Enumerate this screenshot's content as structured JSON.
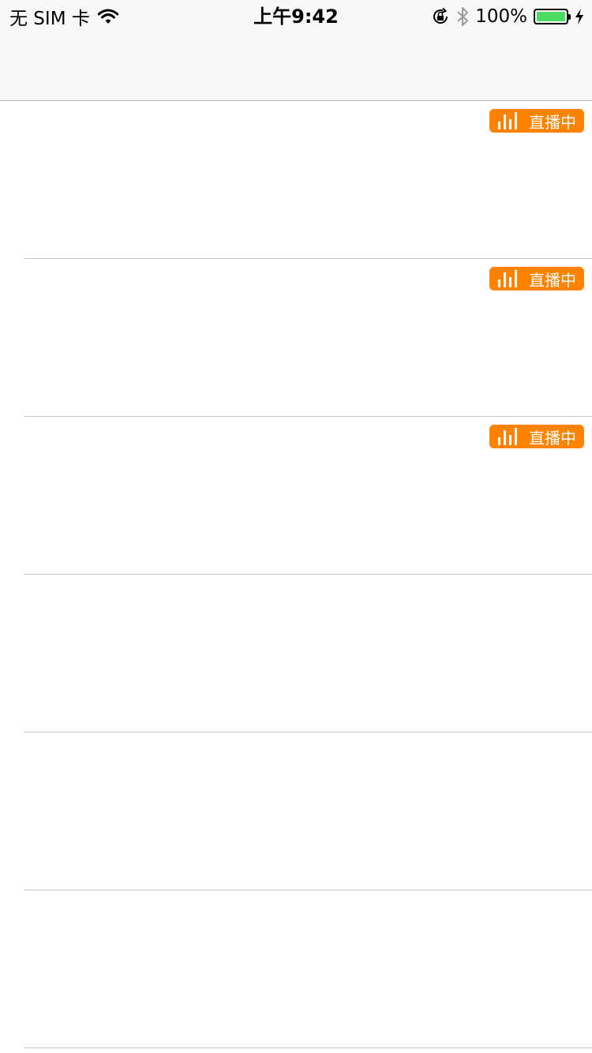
{
  "status_bar": {
    "carrier": "无 SIM 卡",
    "time": "上午9:42",
    "battery_percent": "100%",
    "battery_level": 1.0,
    "battery_color": "#4cd964"
  },
  "navigation": {
    "title": ""
  },
  "live_badge": {
    "text": "直播中",
    "color": "#ff8200",
    "icon": "audio-bars-icon"
  },
  "list": {
    "rows": [
      {
        "live": true,
        "badge_label": "直播中"
      },
      {
        "live": true,
        "badge_label": "直播中"
      },
      {
        "live": true,
        "badge_label": "直播中"
      },
      {
        "live": false
      },
      {
        "live": false
      },
      {
        "live": false
      }
    ]
  }
}
